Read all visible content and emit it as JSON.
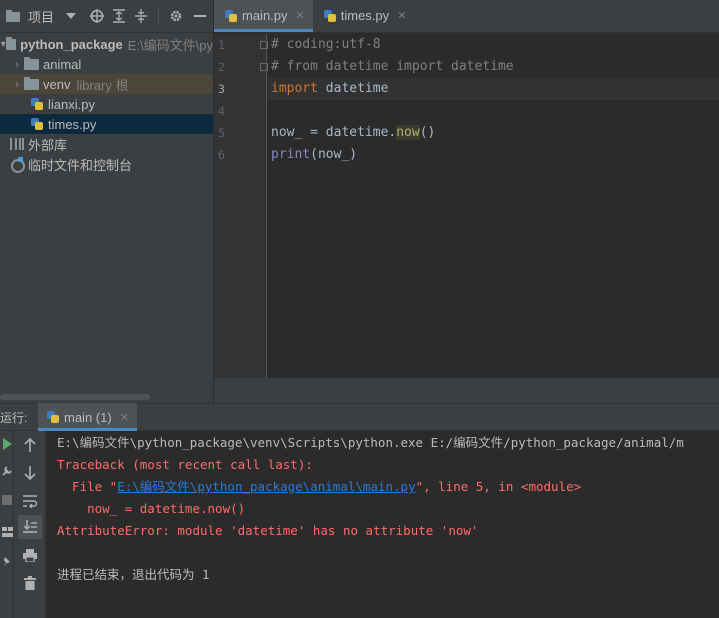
{
  "project_panel": {
    "title": "项目",
    "tree": [
      {
        "label": "python_package",
        "hint": "E:\\编码文件\\py",
        "type": "folder",
        "expanded": true
      },
      {
        "label": "animal",
        "type": "folder",
        "expanded": false
      },
      {
        "label": "venv",
        "hint": "library 根",
        "type": "folder",
        "expanded": false
      },
      {
        "label": "lianxi.py",
        "type": "py"
      },
      {
        "label": "times.py",
        "type": "py",
        "selected": true
      },
      {
        "label": "外部库",
        "type": "lib"
      },
      {
        "label": "临时文件和控制台",
        "type": "scratch"
      }
    ]
  },
  "editor": {
    "tabs": [
      {
        "label": "main.py",
        "active": true
      },
      {
        "label": "times.py",
        "active": false
      }
    ],
    "line_numbers": [
      "1",
      "2",
      "3",
      "4",
      "5",
      "6"
    ],
    "current_line": 3,
    "code": {
      "l1": "# coding:utf-8",
      "l2": "# from datetime import datetime",
      "l3_kw": "import",
      "l3_rest": " datetime",
      "l4": "",
      "l5_a": "now_ = datetime.",
      "l5_b": "now",
      "l5_c": "()",
      "l6_fn": "print",
      "l6_rest": "(now_)"
    }
  },
  "run_panel": {
    "label": "运行:",
    "tab_label": "main (1)",
    "console": {
      "cmd": "E:\\编码文件\\python_package\\venv\\Scripts\\python.exe E:/编码文件/python_package/animal/m",
      "traceback": "Traceback (most recent call last):",
      "file_prefix": "  File \"",
      "file_link": "E:\\编码文件\\python_package\\animal\\main.py",
      "file_suffix": "\", line 5, in <module>",
      "code_line": "    now_ = datetime.now()",
      "error": "AttributeError: module 'datetime' has no attribute 'now'",
      "exit": "进程已结束，退出代码为 1"
    }
  },
  "icons": [
    "folder-icon",
    "dropdown-icon",
    "locate-icon",
    "expand-all-icon",
    "collapse-all-icon",
    "gear-icon",
    "minimize-icon",
    "python-file-icon",
    "close-icon",
    "up-arrow-icon",
    "down-arrow-icon",
    "wrap-icon",
    "scroll-to-end-icon",
    "print-icon",
    "trash-icon",
    "rerun-icon",
    "wrench-icon",
    "stop-icon",
    "layout-icon",
    "pin-icon"
  ]
}
